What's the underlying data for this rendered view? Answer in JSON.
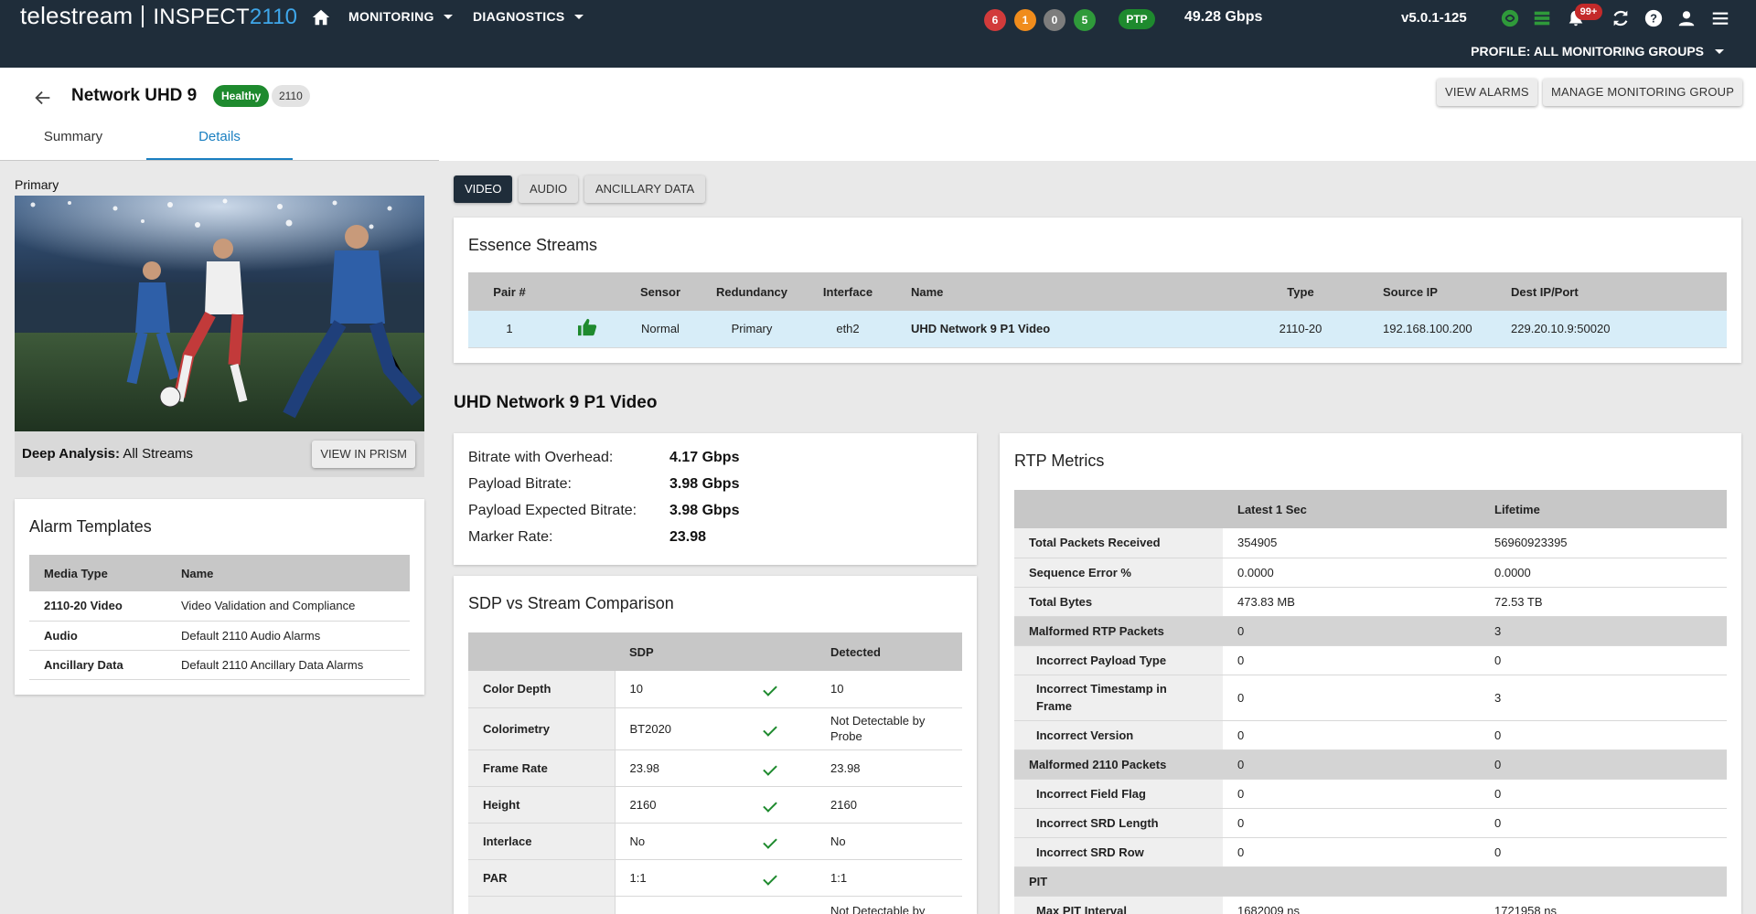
{
  "app": {
    "brand": "telestream",
    "product": "INSPECT",
    "product_num": "2110",
    "nav": [
      {
        "label": "MONITORING"
      },
      {
        "label": "DIAGNOSTICS"
      }
    ],
    "alarm_counts": [
      {
        "value": "6",
        "color": "#d23b3b"
      },
      {
        "value": "1",
        "color": "#f08c1c"
      },
      {
        "value": "0",
        "color": "#7d7d7d"
      },
      {
        "value": "5",
        "color": "#2f9a3a"
      }
    ],
    "ptp_label": "PTP",
    "total_bitrate": "49.28 Gbps",
    "version": "v5.0.1-125",
    "notification_badge": "99+",
    "profile_label": "PROFILE: ALL MONITORING GROUPS"
  },
  "header": {
    "title": "Network UHD 9",
    "status": "Healthy",
    "type": "2110",
    "view_alarms": "VIEW ALARMS",
    "manage_group": "MANAGE MONITORING GROUP",
    "tabs": [
      {
        "label": "Summary",
        "active": false
      },
      {
        "label": "Details",
        "active": true
      }
    ]
  },
  "left": {
    "primary_label": "Primary",
    "deep_analysis_label": "Deep Analysis:",
    "deep_analysis_value": "All Streams",
    "view_in_prism": "VIEW IN PRISM",
    "alarm_templates": {
      "title": "Alarm Templates",
      "columns": [
        "Media Type",
        "Name"
      ],
      "rows": [
        {
          "media": "2110-20 Video",
          "name": "Video Validation and Compliance"
        },
        {
          "media": "Audio",
          "name": "Default 2110 Audio Alarms"
        },
        {
          "media": "Ancillary Data",
          "name": "Default 2110 Ancillary Data Alarms"
        }
      ]
    }
  },
  "stream_tabs": [
    {
      "label": "VIDEO",
      "active": true
    },
    {
      "label": "AUDIO",
      "active": false
    },
    {
      "label": "ANCILLARY DATA",
      "active": false
    }
  ],
  "essence": {
    "title": "Essence Streams",
    "columns": [
      "Pair #",
      "Sensor",
      "Redundancy",
      "Interface",
      "Name",
      "Type",
      "Source IP",
      "Dest IP/Port"
    ],
    "row": {
      "pair": "1",
      "sensor": "Normal",
      "redundancy": "Primary",
      "interface": "eth2",
      "name": "UHD Network 9 P1 Video",
      "type": "2110-20",
      "source_ip": "192.168.100.200",
      "dest": "229.20.10.9:50020"
    }
  },
  "stream_detail": {
    "heading": "UHD Network 9 P1 Video",
    "bitrates": [
      {
        "label": "Bitrate with Overhead:",
        "value": "4.17 Gbps"
      },
      {
        "label": "Payload Bitrate:",
        "value": "3.98 Gbps"
      },
      {
        "label": "Payload Expected Bitrate:",
        "value": "3.98 Gbps"
      },
      {
        "label": "Marker Rate:",
        "value": "23.98"
      }
    ]
  },
  "sdp": {
    "title": "SDP vs Stream Comparison",
    "columns": [
      "",
      "SDP",
      "",
      "Detected"
    ],
    "rows": [
      {
        "label": "Color Depth",
        "sdp": "10",
        "detected": "10"
      },
      {
        "label": "Colorimetry",
        "sdp": "BT2020",
        "detected": "Not Detectable by Probe"
      },
      {
        "label": "Frame Rate",
        "sdp": "23.98",
        "detected": "23.98"
      },
      {
        "label": "Height",
        "sdp": "2160",
        "detected": "2160"
      },
      {
        "label": "Interlace",
        "sdp": "No",
        "detected": "No"
      },
      {
        "label": "PAR",
        "sdp": "1:1",
        "detected": "1:1"
      },
      {
        "label": "",
        "sdp": "",
        "detected": "Not Detectable by"
      }
    ]
  },
  "rtp": {
    "title": "RTP Metrics",
    "columns": [
      "",
      "Latest 1 Sec",
      "Lifetime"
    ],
    "rows": [
      {
        "label": "Total Packets Received",
        "latest": "354905",
        "lifetime": "56960923395",
        "group": false,
        "indent": false
      },
      {
        "label": "Sequence Error %",
        "latest": "0.0000",
        "lifetime": "0.0000",
        "group": false,
        "indent": false
      },
      {
        "label": "Total Bytes",
        "latest": "473.83 MB",
        "lifetime": "72.53 TB",
        "group": false,
        "indent": false
      },
      {
        "label": "Malformed RTP Packets",
        "latest": "0",
        "lifetime": "3",
        "group": true,
        "indent": false
      },
      {
        "label": "Incorrect Payload Type",
        "latest": "0",
        "lifetime": "0",
        "group": false,
        "indent": true
      },
      {
        "label": "Incorrect Timestamp in Frame",
        "latest": "0",
        "lifetime": "3",
        "group": false,
        "indent": true
      },
      {
        "label": "Incorrect Version",
        "latest": "0",
        "lifetime": "0",
        "group": false,
        "indent": true
      },
      {
        "label": "Malformed 2110 Packets",
        "latest": "0",
        "lifetime": "0",
        "group": true,
        "indent": false
      },
      {
        "label": "Incorrect Field Flag",
        "latest": "0",
        "lifetime": "0",
        "group": false,
        "indent": true
      },
      {
        "label": "Incorrect SRD Length",
        "latest": "0",
        "lifetime": "0",
        "group": false,
        "indent": true
      },
      {
        "label": "Incorrect SRD Row",
        "latest": "0",
        "lifetime": "0",
        "group": false,
        "indent": true
      },
      {
        "label": "PIT",
        "latest": "",
        "lifetime": "",
        "group": true,
        "indent": false
      },
      {
        "label": "Max PIT Interval",
        "latest": "1682009 ns",
        "lifetime": "1721958 ns",
        "group": false,
        "indent": true
      }
    ]
  }
}
